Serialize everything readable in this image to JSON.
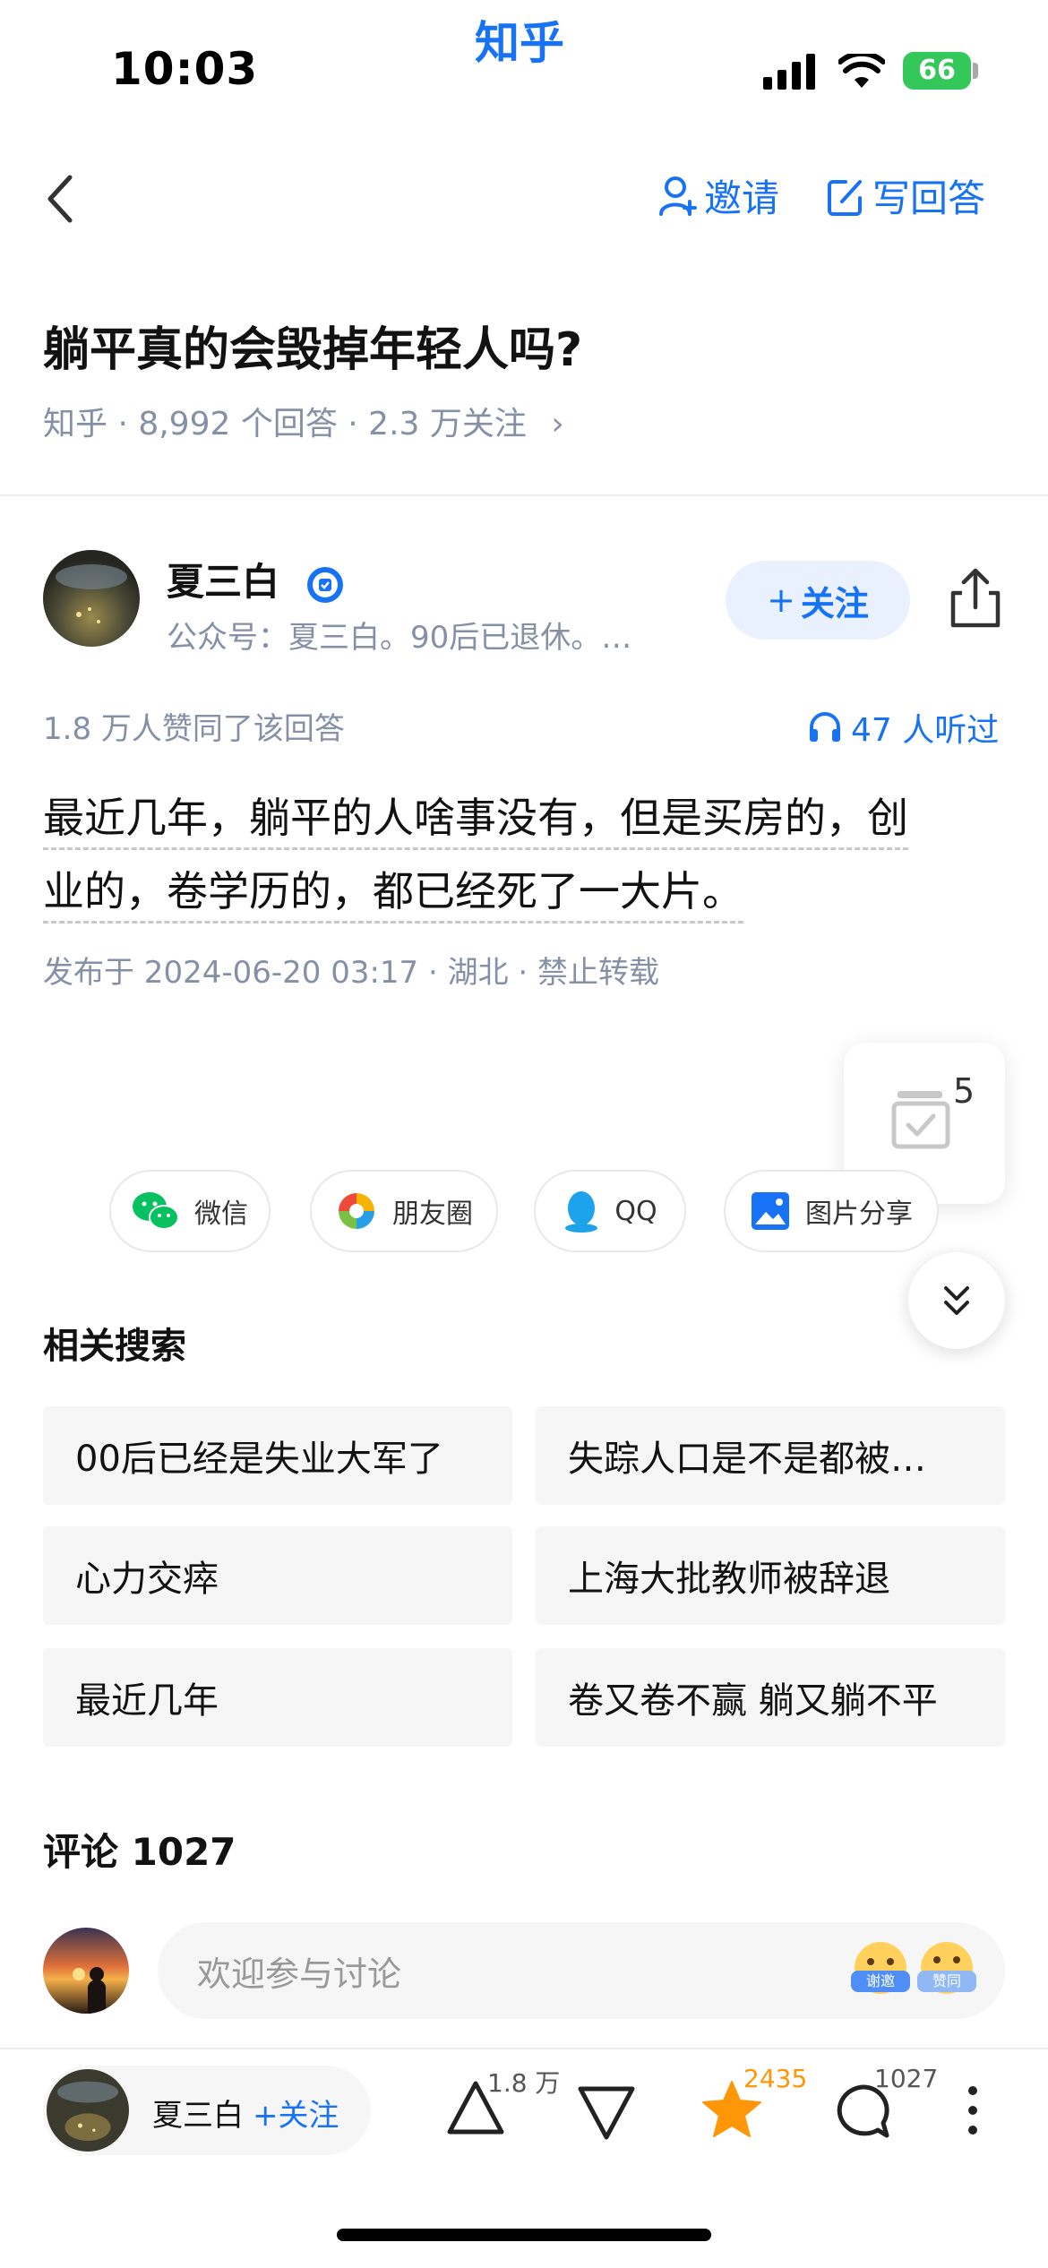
{
  "status_bar": {
    "time": "10:03",
    "app_name": "知乎",
    "battery": "66"
  },
  "header": {
    "invite_label": "邀请",
    "write_answer_label": "写回答"
  },
  "question": {
    "title": "躺平真的会毁掉年轻人吗?",
    "meta": "知乎 · 8,992 个回答 · 2.3 万关注"
  },
  "author": {
    "name": "夏三白",
    "subtitle": "公众号：夏三白。90后已退休。…",
    "follow_label": "关注"
  },
  "answer": {
    "likes_text": "1.8 万人赞同了该回答",
    "listened_text": "47 人听过",
    "line1": "最近几年，躺平的人啥事没有，但是买房的，创",
    "line2": "业的，卷学历的，都已经死了一大片。",
    "publish_info": "发布于 2024-06-20 03:17 · 湖北 · 禁止转载"
  },
  "floating_badge": {
    "count": "5"
  },
  "share": {
    "wechat": "微信",
    "moments": "朋友圈",
    "qq": "QQ",
    "image_share": "图片分享"
  },
  "related": {
    "title": "相关搜索",
    "items": [
      "00后已经是失业大军了",
      "失踪人口是不是都被…",
      "心力交瘁",
      "上海大批教师被辞退",
      "最近几年",
      "卷又卷不赢 躺又躺不平"
    ]
  },
  "comments": {
    "title": "评论 1027",
    "input_placeholder": "欢迎参与讨论",
    "emoji_1": "谢邀",
    "emoji_2": "赞同"
  },
  "bottom_bar": {
    "author_name": "夏三白",
    "follow_label": "关注",
    "upvote_count": "1.8 万",
    "favorite_count": "2435",
    "comment_count": "1027"
  },
  "colors": {
    "accent": "#1772f6",
    "favorite": "#ff9607",
    "meta": "#8590a6"
  }
}
